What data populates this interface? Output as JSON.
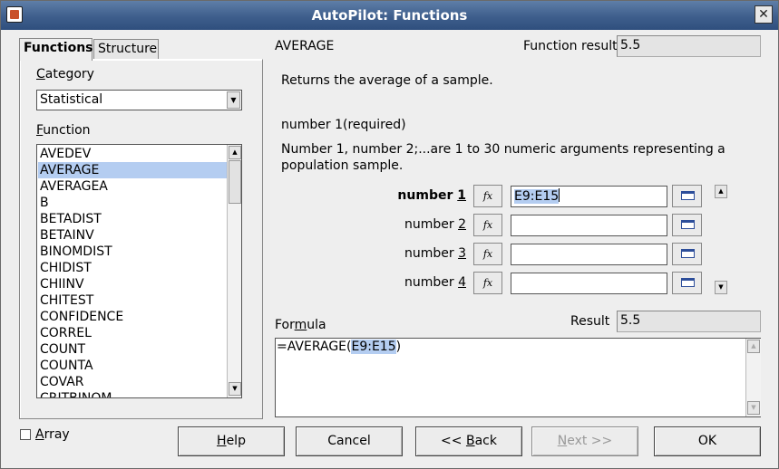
{
  "window": {
    "title": "AutoPilot: Functions",
    "close_glyph": "✕"
  },
  "tabs": [
    {
      "label": "Functions",
      "active": true
    },
    {
      "label": "Structure",
      "active": false
    }
  ],
  "left": {
    "category_label": "Category",
    "category_value": "Statistical",
    "function_label": "Function",
    "functions": [
      "AVEDEV",
      "AVERAGE",
      "AVERAGEA",
      "B",
      "BETADIST",
      "BETAINV",
      "BINOMDIST",
      "CHIDIST",
      "CHIINV",
      "CHITEST",
      "CONFIDENCE",
      "CORREL",
      "COUNT",
      "COUNTA",
      "COVAR",
      "CRITBINOM"
    ],
    "selected_function": "AVERAGE"
  },
  "right": {
    "function_name": "AVERAGE",
    "function_result_label": "Function result",
    "function_result_value": "5.5",
    "description": "Returns the average of a sample.",
    "arg_title": "number 1(required)",
    "arg_description_line1": "Number 1, number 2;...are 1 to 30 numeric arguments representing a",
    "arg_description_line2": "population sample.",
    "fx_glyph": "fx",
    "args": [
      {
        "label": "number",
        "index": "1",
        "value": "E9:E15",
        "active": true
      },
      {
        "label": "number",
        "index": "2",
        "value": "",
        "active": false
      },
      {
        "label": "number",
        "index": "3",
        "value": "",
        "active": false
      },
      {
        "label": "number",
        "index": "4",
        "value": "",
        "active": false
      }
    ],
    "formula_label": "Formula",
    "result_label": "Result",
    "result_value": "5.5",
    "formula_prefix": "=AVERAGE(",
    "formula_ref": "E9:E15",
    "formula_suffix": ")"
  },
  "bottom": {
    "array_label": "Array",
    "buttons": {
      "help": "Help",
      "cancel": "Cancel",
      "back": "<< Back",
      "next": "Next >>",
      "ok": "OK"
    }
  },
  "icons": {
    "app": "calc-app-icon",
    "close": "close-icon",
    "fx": "function-wizard-icon",
    "shrink": "shrink-dialog-icon"
  }
}
